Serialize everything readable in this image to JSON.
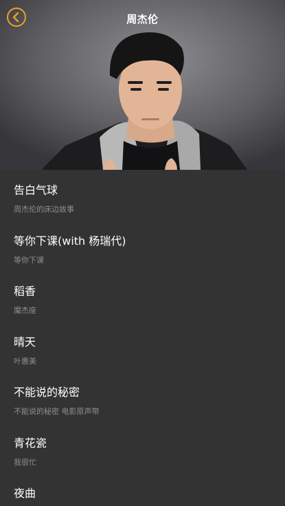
{
  "header": {
    "title": "周杰伦",
    "back_icon": "chevron-left-icon",
    "accent_color": "#f0a020"
  },
  "songs": [
    {
      "title": "告白气球",
      "album": "周杰伦的床边故事"
    },
    {
      "title": "等你下课(with 杨瑞代)",
      "album": "等你下课"
    },
    {
      "title": "稻香",
      "album": "魔杰座"
    },
    {
      "title": "晴天",
      "album": "叶惠美"
    },
    {
      "title": "不能说的秘密",
      "album": "不能说的秘密 电影原声带"
    },
    {
      "title": "青花瓷",
      "album": "我很忙"
    },
    {
      "title": "夜曲",
      "album": ""
    }
  ]
}
